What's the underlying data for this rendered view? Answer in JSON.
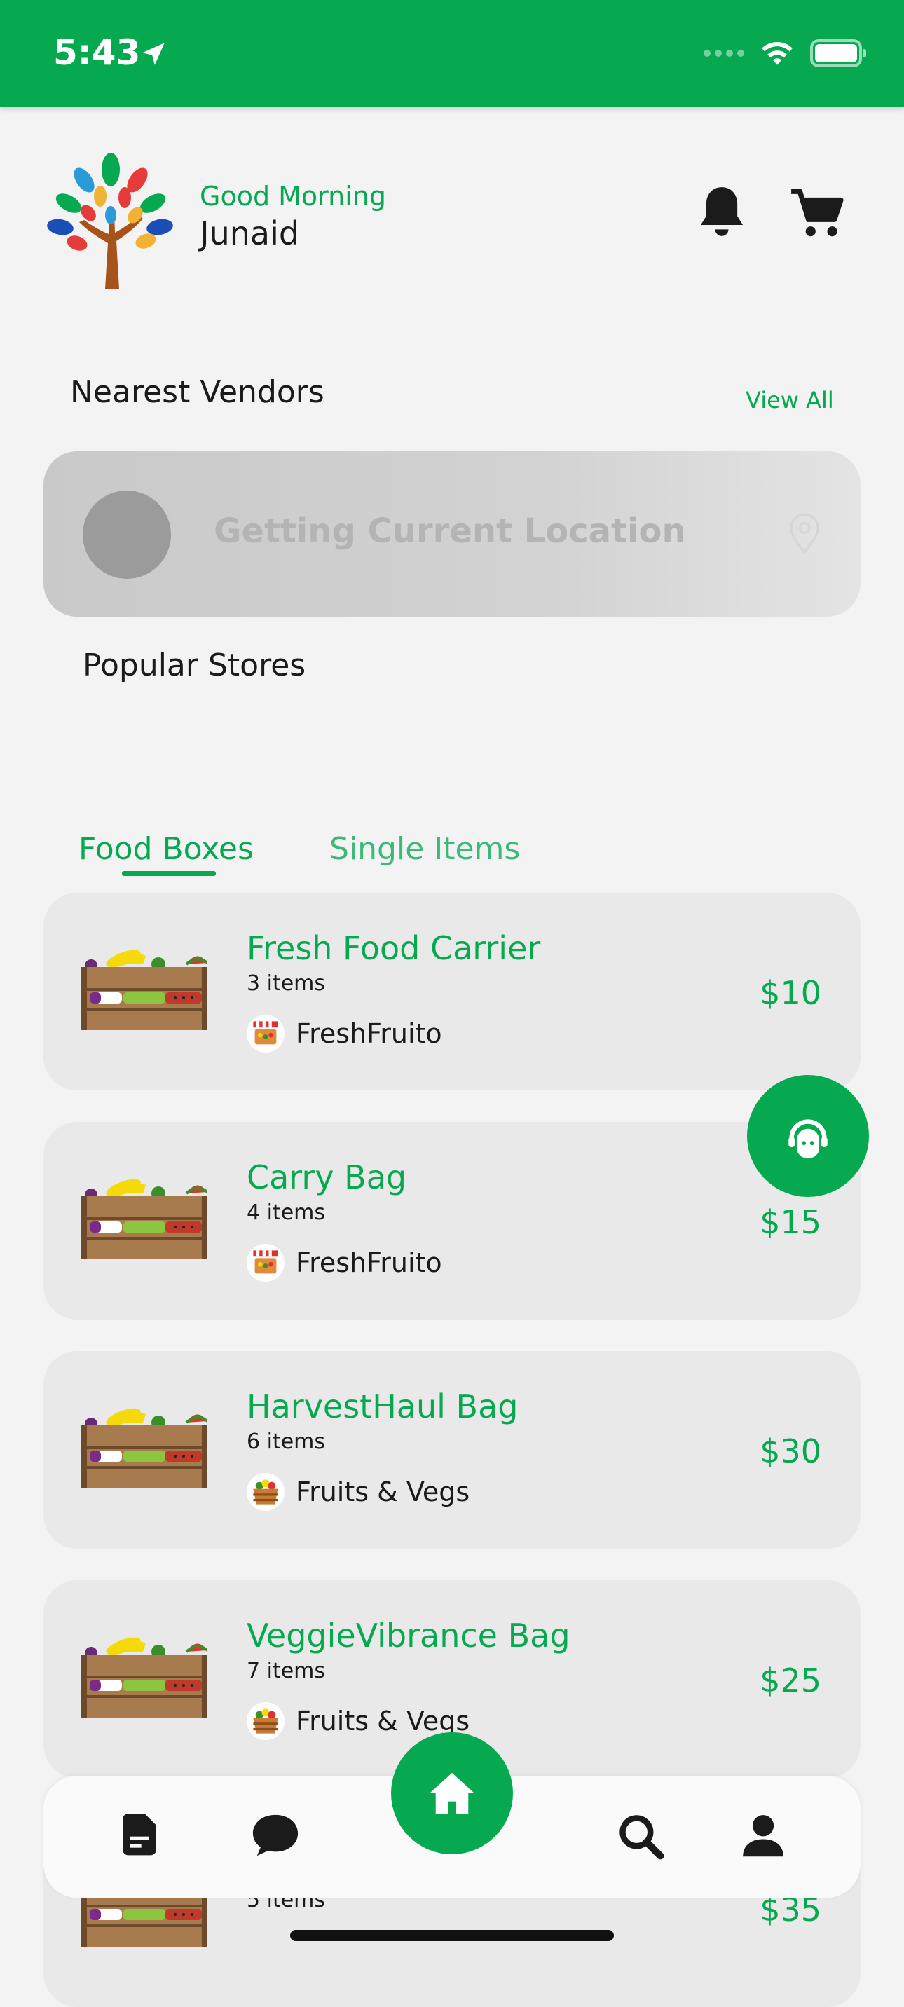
{
  "status_bar": {
    "time": "5:43"
  },
  "header": {
    "greeting": "Good Morning",
    "username": "Junaid"
  },
  "nearest_vendors": {
    "title": "Nearest Vendors",
    "view_all": "View All",
    "location_text": "Getting Current Location"
  },
  "popular_stores": {
    "title": "Popular Stores"
  },
  "tabs": [
    {
      "label": "Food Boxes",
      "active": true
    },
    {
      "label": "Single Items",
      "active": false
    }
  ],
  "products": [
    {
      "name": "Fresh Food Carrier",
      "count": "3 items",
      "store": "FreshFruito",
      "price": "$10"
    },
    {
      "name": "Carry Bag",
      "count": "4 items",
      "store": "FreshFruito",
      "price": "$15"
    },
    {
      "name": "HarvestHaul Bag",
      "count": "6 items",
      "store": "Fruits & Vegs",
      "price": "$30"
    },
    {
      "name": "VeggieVibrance Bag",
      "count": "7 items",
      "store": "Fruits & Vegs",
      "price": "$25"
    },
    {
      "name": "",
      "count": "5 items",
      "store": "",
      "price": "$35"
    }
  ],
  "colors": {
    "brand_green": "#06a94f",
    "background": "#f3f3f3",
    "card": "#e9e9e9"
  },
  "icons": {
    "notifications": "bell-icon",
    "cart": "cart-icon",
    "support": "headset-icon",
    "home": "home-icon",
    "orders": "document-icon",
    "chat": "chat-icon",
    "search": "search-icon",
    "profile": "user-icon"
  }
}
